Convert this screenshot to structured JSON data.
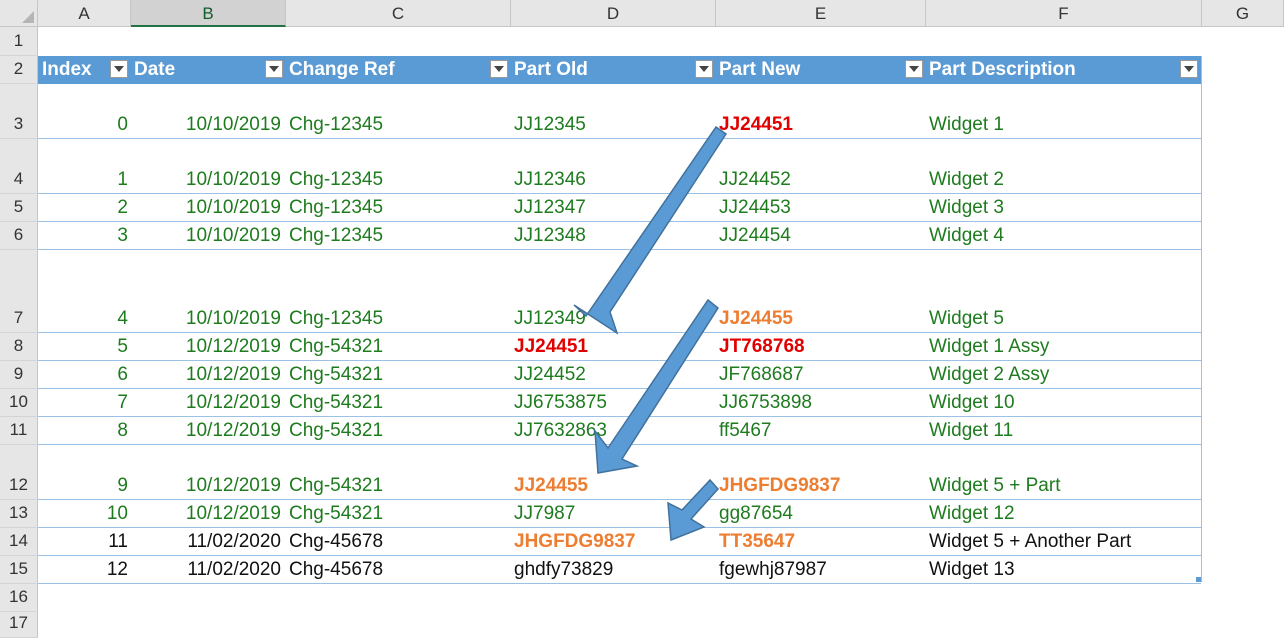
{
  "columns": [
    "A",
    "B",
    "C",
    "D",
    "E",
    "F",
    "G"
  ],
  "row_numbers": [
    "1",
    "2",
    "3",
    "4",
    "5",
    "6",
    "7",
    "8",
    "9",
    "10",
    "11",
    "12",
    "13",
    "14",
    "15",
    "16",
    "17"
  ],
  "table": {
    "headers": [
      "Index",
      "Date",
      "Change Ref",
      "Part Old",
      "Part New",
      "Part Description"
    ],
    "rows": [
      {
        "index": "0",
        "date": "10/10/2019",
        "ref": "Chg-12345",
        "old": "JJ12345",
        "new": "JJ24451",
        "desc": "Widget 1"
      },
      {
        "index": "1",
        "date": "10/10/2019",
        "ref": "Chg-12345",
        "old": "JJ12346",
        "new": "JJ24452",
        "desc": "Widget 2"
      },
      {
        "index": "2",
        "date": "10/10/2019",
        "ref": "Chg-12345",
        "old": "JJ12347",
        "new": "JJ24453",
        "desc": "Widget 3"
      },
      {
        "index": "3",
        "date": "10/10/2019",
        "ref": "Chg-12345",
        "old": "JJ12348",
        "new": "JJ24454",
        "desc": "Widget 4"
      },
      {
        "index": "4",
        "date": "10/10/2019",
        "ref": "Chg-12345",
        "old": "JJ12349",
        "new": "JJ24455",
        "desc": "Widget 5"
      },
      {
        "index": "5",
        "date": "10/12/2019",
        "ref": "Chg-54321",
        "old": "JJ24451",
        "new": "JT768768",
        "desc": "Widget 1 Assy"
      },
      {
        "index": "6",
        "date": "10/12/2019",
        "ref": "Chg-54321",
        "old": "JJ24452",
        "new": "JF768687",
        "desc": "Widget 2 Assy"
      },
      {
        "index": "7",
        "date": "10/12/2019",
        "ref": "Chg-54321",
        "old": "JJ6753875",
        "new": "JJ6753898",
        "desc": "Widget 10"
      },
      {
        "index": "8",
        "date": "10/12/2019",
        "ref": "Chg-54321",
        "old": "JJ7632863",
        "new": "ff5467",
        "desc": "Widget 11"
      },
      {
        "index": "9",
        "date": "10/12/2019",
        "ref": "Chg-54321",
        "old": "JJ24455",
        "new": "JHGFDG9837",
        "desc": "Widget 5 + Part"
      },
      {
        "index": "10",
        "date": "10/12/2019",
        "ref": "Chg-54321",
        "old": "JJ7987",
        "new": "gg87654",
        "desc": "Widget 12"
      },
      {
        "index": "11",
        "date": "11/02/2020",
        "ref": "Chg-45678",
        "old": "JHGFDG9837",
        "new": "TT35647",
        "desc": "Widget 5 + Another Part"
      },
      {
        "index": "12",
        "date": "11/02/2020",
        "ref": "Chg-45678",
        "old": "ghdfy73829",
        "new": "fgewhj87987",
        "desc": "Widget 13"
      }
    ]
  },
  "colors": {
    "header_fill": "#5b9bd5",
    "text_green": "#1e7b1e",
    "highlight_red": "#e00000",
    "highlight_orange": "#ed7d31",
    "arrow_fill": "#5b9bd5",
    "arrow_stroke": "#41719c"
  }
}
